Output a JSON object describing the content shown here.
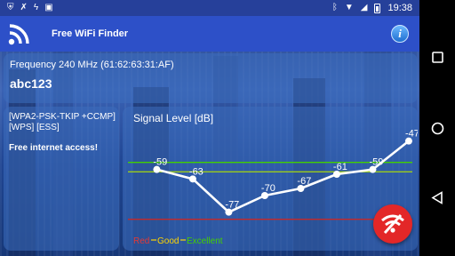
{
  "status_bar": {
    "time": "19:38",
    "left_icons": [
      "shield-icon",
      "missed-call-icon",
      "flash-off-icon",
      "android-icon"
    ],
    "right_icons": [
      "bluetooth-icon",
      "wifi-icon",
      "signal-off-icon",
      "battery-icon"
    ]
  },
  "app_bar": {
    "title": "Free WiFi Finder",
    "logo_icon": "wifi-rss-icon",
    "info_icon": "info-icon"
  },
  "network": {
    "frequency_line": "Frequency 240 MHz (61:62:63:31:AF)",
    "ssid": "abc123",
    "security": "[WPA2-PSK-TKIP +CCMP] [WPS] [ESS]",
    "access_note": "Free internet access!"
  },
  "chart_data": {
    "type": "line",
    "title": "Signal Level [dB]",
    "x": [
      1,
      2,
      3,
      4,
      5,
      6,
      7,
      8
    ],
    "series": [
      {
        "values": [
          -59,
          -63,
          -77,
          -70,
          -67,
          -61,
          -59,
          -47
        ]
      }
    ],
    "data_labels": [
      "-59",
      "-63",
      "-77",
      "-70",
      "-67",
      "-61",
      "-59",
      "-47"
    ],
    "ylim": [
      -85,
      -40
    ],
    "reference_lines": [
      {
        "value": -80,
        "color": "#c62828"
      },
      {
        "value": -60,
        "color": "#9ccc1a"
      },
      {
        "value": -56,
        "color": "#44d000"
      }
    ],
    "legend": [
      {
        "name": "Red",
        "color": "#e53935"
      },
      {
        "name": "Good",
        "color": "#ffd600"
      },
      {
        "name": "Excellent",
        "color": "#44d000"
      }
    ],
    "legend_placement": "bottom-left",
    "grid": false
  },
  "fab": {
    "icon": "wifi-off-icon",
    "color": "#e32728"
  },
  "nav": {
    "icons": [
      "square-icon",
      "circle-icon",
      "triangle-back-icon"
    ]
  }
}
